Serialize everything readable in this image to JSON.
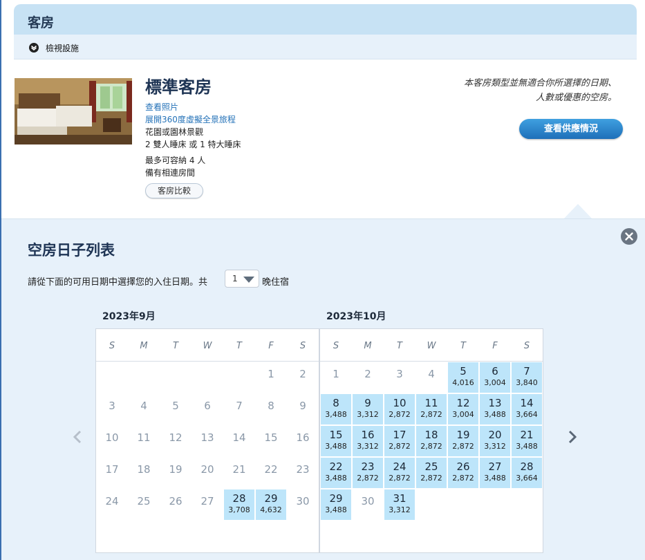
{
  "section": {
    "title": "客房",
    "sub_label": "檢視設施"
  },
  "room": {
    "name": "標準客房",
    "links": [
      "查看照片",
      "展開360度虛擬全景旅程"
    ],
    "info": [
      "花園或園林景觀",
      "2 雙人睡床 或 1 特大睡床",
      "最多可容納 4 人",
      "備有相連房間"
    ],
    "compare_label": "客房比較",
    "notice": "本客房類型並無適合你所選擇的日期、人數或優惠的空房。",
    "availability_button": "查看供應情況"
  },
  "calendar": {
    "title": "空房日子列表",
    "instruction_pre": "請從下面的可用日期中選擇您的入住日期。共",
    "nights_value": "1",
    "instruction_post": "晚住宿",
    "weekdays": [
      "S",
      "M",
      "T",
      "W",
      "T",
      "F",
      "S"
    ],
    "accent_color": "#bde5fa",
    "months": [
      {
        "label": "2023年9月",
        "first_weekday": 5,
        "days": [
          {
            "d": "1"
          },
          {
            "d": "2"
          },
          {
            "d": "3"
          },
          {
            "d": "4"
          },
          {
            "d": "5"
          },
          {
            "d": "6"
          },
          {
            "d": "7"
          },
          {
            "d": "8"
          },
          {
            "d": "9"
          },
          {
            "d": "10"
          },
          {
            "d": "11"
          },
          {
            "d": "12"
          },
          {
            "d": "13"
          },
          {
            "d": "14"
          },
          {
            "d": "15"
          },
          {
            "d": "16"
          },
          {
            "d": "17"
          },
          {
            "d": "18"
          },
          {
            "d": "19"
          },
          {
            "d": "20"
          },
          {
            "d": "21"
          },
          {
            "d": "22"
          },
          {
            "d": "23"
          },
          {
            "d": "24"
          },
          {
            "d": "25"
          },
          {
            "d": "26"
          },
          {
            "d": "27"
          },
          {
            "d": "28",
            "p": "3,708"
          },
          {
            "d": "29",
            "p": "4,632"
          },
          {
            "d": "30"
          }
        ]
      },
      {
        "label": "2023年10月",
        "first_weekday": 0,
        "days": [
          {
            "d": "1"
          },
          {
            "d": "2"
          },
          {
            "d": "3"
          },
          {
            "d": "4"
          },
          {
            "d": "5",
            "p": "4,016"
          },
          {
            "d": "6",
            "p": "3,004"
          },
          {
            "d": "7",
            "p": "3,840"
          },
          {
            "d": "8",
            "p": "3,488"
          },
          {
            "d": "9",
            "p": "3,312"
          },
          {
            "d": "10",
            "p": "2,872"
          },
          {
            "d": "11",
            "p": "2,872"
          },
          {
            "d": "12",
            "p": "3,004"
          },
          {
            "d": "13",
            "p": "3,488"
          },
          {
            "d": "14",
            "p": "3,664"
          },
          {
            "d": "15",
            "p": "3,488"
          },
          {
            "d": "16",
            "p": "3,312"
          },
          {
            "d": "17",
            "p": "2,872"
          },
          {
            "d": "18",
            "p": "2,872"
          },
          {
            "d": "19",
            "p": "2,872"
          },
          {
            "d": "20",
            "p": "3,312"
          },
          {
            "d": "21",
            "p": "3,488"
          },
          {
            "d": "22",
            "p": "3,488"
          },
          {
            "d": "23",
            "p": "2,872"
          },
          {
            "d": "24",
            "p": "2,872"
          },
          {
            "d": "25",
            "p": "2,872"
          },
          {
            "d": "26",
            "p": "2,872"
          },
          {
            "d": "27",
            "p": "3,488"
          },
          {
            "d": "28",
            "p": "3,664"
          },
          {
            "d": "29",
            "p": "3,488"
          },
          {
            "d": "30"
          },
          {
            "d": "31",
            "p": "3,312"
          }
        ]
      }
    ]
  }
}
